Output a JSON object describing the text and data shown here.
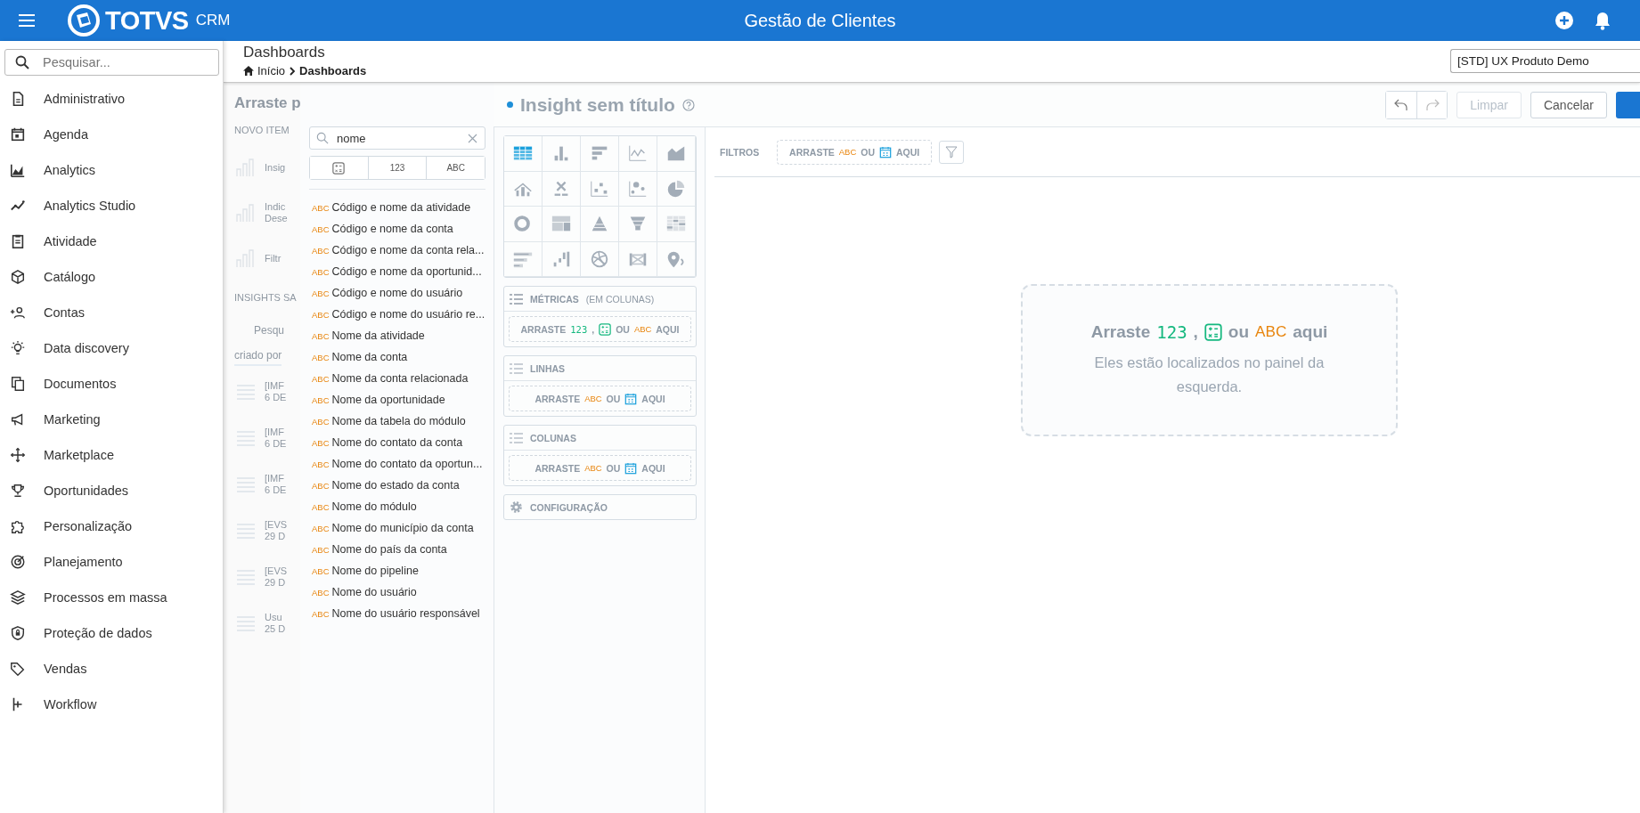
{
  "header": {
    "logo_text": "TOTVS",
    "logo_suffix": "CRM",
    "title": "Gestão de Clientes"
  },
  "sidebar": {
    "search_placeholder": "Pesquisar...",
    "items": [
      {
        "label": "Administrativo"
      },
      {
        "label": "Agenda"
      },
      {
        "label": "Analytics"
      },
      {
        "label": "Analytics Studio"
      },
      {
        "label": "Atividade"
      },
      {
        "label": "Catálogo"
      },
      {
        "label": "Contas"
      },
      {
        "label": "Data discovery"
      },
      {
        "label": "Documentos"
      },
      {
        "label": "Marketing"
      },
      {
        "label": "Marketplace"
      },
      {
        "label": "Oportunidades"
      },
      {
        "label": "Personalização"
      },
      {
        "label": "Planejamento"
      },
      {
        "label": "Processos em massa"
      },
      {
        "label": "Proteção de dados"
      },
      {
        "label": "Vendas"
      },
      {
        "label": "Workflow"
      }
    ]
  },
  "page": {
    "title": "Dashboards",
    "breadcrumb": [
      "Início",
      "Dashboards"
    ],
    "workspace": "[STD] UX Produto Demo"
  },
  "background_panel": {
    "heading": "Arraste p",
    "section": "NOVO ITEM",
    "items": [
      {
        "lines": [
          "Insig"
        ]
      },
      {
        "lines": [
          "Indic",
          "Dese"
        ]
      },
      {
        "lines": [
          "Filtr"
        ]
      }
    ],
    "section_2": "INSIGHTS SA",
    "search": "Pesqu",
    "sort": "criado por",
    "rows": [
      {
        "lines": [
          "[IMF",
          "6 DE"
        ]
      },
      {
        "lines": [
          "[IMF",
          "6 DE"
        ]
      },
      {
        "lines": [
          "[IMF",
          "6 DE"
        ]
      },
      {
        "lines": [
          "[EVS",
          "29 D"
        ]
      },
      {
        "lines": [
          "[EVS",
          "29 D"
        ]
      },
      {
        "lines": [
          "Usu",
          "25 D"
        ]
      }
    ]
  },
  "insight": {
    "title": "Insight sem título",
    "buttons": [
      {
        "label": "Limpar",
        "disabled": true
      },
      {
        "label": "Cancelar",
        "disabled": false
      }
    ]
  },
  "field_panel": {
    "search_value": "nome",
    "type_filters": [
      {
        "kind": "calc"
      },
      {
        "kind": "text",
        "label": "123"
      },
      {
        "kind": "text",
        "label": "ABC"
      }
    ],
    "fields": [
      {
        "tag": "ABC",
        "label": "Código e nome da atividade"
      },
      {
        "tag": "ABC",
        "label": "Código e nome da conta"
      },
      {
        "tag": "ABC",
        "label": "Código e nome da conta rela..."
      },
      {
        "tag": "ABC",
        "label": "Código e nome da oportunid..."
      },
      {
        "tag": "ABC",
        "label": "Código e nome do usuário"
      },
      {
        "tag": "ABC",
        "label": "Código e nome do usuário re..."
      },
      {
        "tag": "ABC",
        "label": "Nome da atividade"
      },
      {
        "tag": "ABC",
        "label": "Nome da conta"
      },
      {
        "tag": "ABC",
        "label": "Nome da conta relacionada"
      },
      {
        "tag": "ABC",
        "label": "Nome da oportunidade"
      },
      {
        "tag": "ABC",
        "label": "Nome da tabela do módulo"
      },
      {
        "tag": "ABC",
        "label": "Nome do contato da conta"
      },
      {
        "tag": "ABC",
        "label": "Nome do contato da oportun..."
      },
      {
        "tag": "ABC",
        "label": "Nome do estado da conta"
      },
      {
        "tag": "ABC",
        "label": "Nome do módulo"
      },
      {
        "tag": "ABC",
        "label": "Nome do município da conta"
      },
      {
        "tag": "ABC",
        "label": "Nome do país da conta"
      },
      {
        "tag": "ABC",
        "label": "Nome do pipeline"
      },
      {
        "tag": "ABC",
        "label": "Nome do usuário"
      },
      {
        "tag": "ABC",
        "label": "Nome do usuário responsável"
      }
    ]
  },
  "chart_types": [
    {
      "selected": true
    },
    {
      "selected": false
    },
    {
      "selected": false
    },
    {
      "selected": false
    },
    {
      "selected": false
    },
    {
      "selected": false
    },
    {
      "selected": false
    },
    {
      "selected": false
    },
    {
      "selected": false
    },
    {
      "selected": false
    },
    {
      "selected": false
    },
    {
      "selected": false
    },
    {
      "selected": false
    },
    {
      "selected": false
    },
    {
      "selected": false
    },
    {
      "selected": false
    },
    {
      "selected": false
    },
    {
      "selected": false
    },
    {
      "selected": false
    },
    {
      "selected": false
    }
  ],
  "buckets": [
    {
      "kind": "metrics",
      "title": "MÉTRICAS",
      "subtitle": "(EM COLUNAS)",
      "drop": [
        {
          "kind": "text",
          "text": "ARRASTE"
        },
        {
          "kind": "metric",
          "text": "123"
        },
        {
          "kind": "text",
          "text": ","
        },
        {
          "kind": "calc"
        },
        {
          "kind": "text",
          "text": "OU"
        },
        {
          "kind": "attr",
          "text": "ABC"
        },
        {
          "kind": "text",
          "text": "AQUI"
        }
      ]
    },
    {
      "kind": "rows",
      "title": "LINHAS",
      "drop": [
        {
          "kind": "text",
          "text": "ARRASTE"
        },
        {
          "kind": "attr",
          "text": "ABC"
        },
        {
          "kind": "text",
          "text": "OU"
        },
        {
          "kind": "date"
        },
        {
          "kind": "text",
          "text": "AQUI"
        }
      ]
    },
    {
      "kind": "columns",
      "title": "COLUNAS",
      "drop": [
        {
          "kind": "text",
          "text": "ARRASTE"
        },
        {
          "kind": "attr",
          "text": "ABC"
        },
        {
          "kind": "text",
          "text": "OU"
        },
        {
          "kind": "date"
        },
        {
          "kind": "text",
          "text": "AQUI"
        }
      ]
    },
    {
      "kind": "settings",
      "title": "CONFIGURAÇÃO"
    }
  ],
  "filters": {
    "label": "FILTROS",
    "drop": [
      {
        "kind": "text",
        "text": "ARRASTE"
      },
      {
        "kind": "attr",
        "text": "ABC"
      },
      {
        "kind": "text",
        "text": "OU"
      },
      {
        "kind": "date"
      },
      {
        "kind": "text",
        "text": "AQUI"
      }
    ]
  },
  "canvas": {
    "title": [
      {
        "kind": "text",
        "text": "Arraste"
      },
      {
        "kind": "metric",
        "text": "123"
      },
      {
        "kind": "text",
        "text": ","
      },
      {
        "kind": "calc"
      },
      {
        "kind": "text",
        "text": "ou"
      },
      {
        "kind": "attr",
        "text": "ABC"
      },
      {
        "kind": "text",
        "text": "aqui"
      }
    ],
    "hint": "Eles estão localizados no painel da esquerda."
  }
}
